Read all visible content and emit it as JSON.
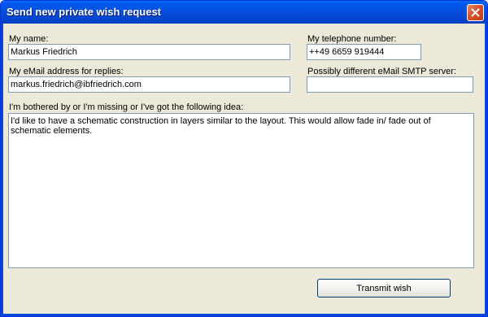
{
  "window": {
    "title": "Send new private wish request"
  },
  "form": {
    "name_label": "My name:",
    "name_value": "Markus Friedrich",
    "phone_label": "My telephone number:",
    "phone_value": "++49 6659 919444",
    "email_label": "My eMail address for replies:",
    "email_value": "markus.friedrich@ibfriedrich.com",
    "smtp_label": "Possibly different eMail SMTP server:",
    "smtp_value": "",
    "idea_label": "I'm bothered by or I'm missing or I've got the following idea:",
    "idea_value": "I'd like to have a schematic construction in layers similar to the layout. This would allow fade in/ fade out of schematic elements."
  },
  "actions": {
    "transmit_label": "Transmit wish"
  },
  "colors": {
    "titlebar": "#0552e0",
    "dialog_background": "#ece9d8",
    "field_border": "#7f9db9"
  }
}
